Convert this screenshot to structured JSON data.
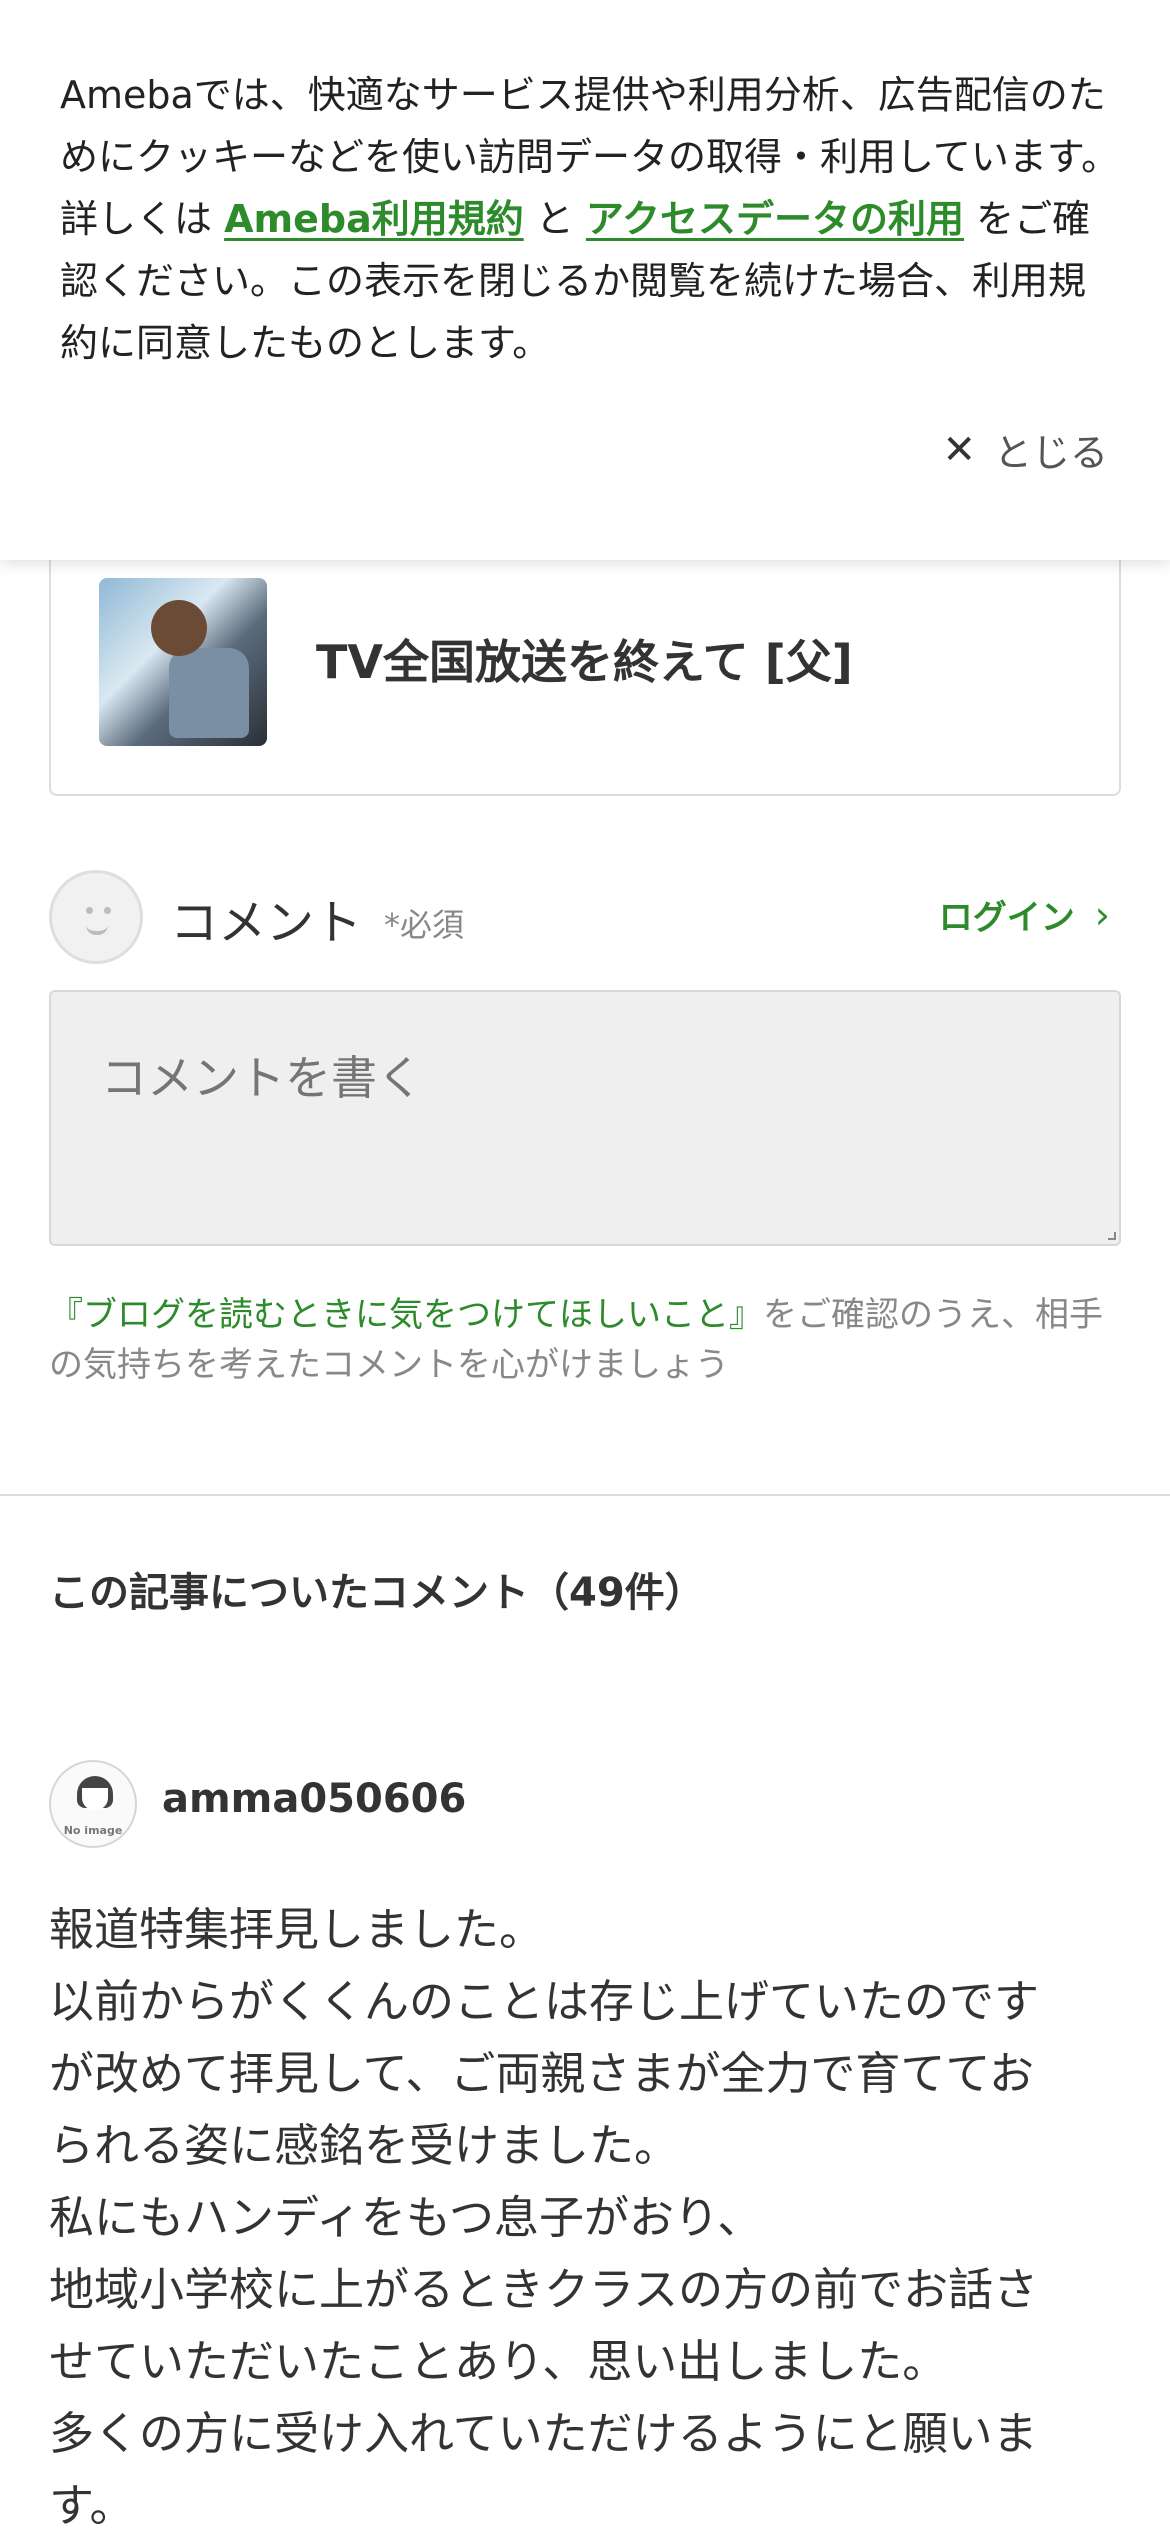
{
  "cookie_banner": {
    "text_1": "Amebaでは、快適なサービス提供や利用分析、広告配信のためにクッキーなどを使い訪問データの取得・利用しています。詳しくは ",
    "link_terms": "Ameba利用規約",
    "text_and": " と ",
    "link_access_data": "アクセスデータの利用",
    "text_2": " をご確認ください。この表示を閉じるか閲覧を続けた場合、利用規約に同意したものとします。",
    "close_label": "とじる",
    "close_icon": "close-icon"
  },
  "article_card": {
    "title": "TV全国放送を終えて [父]"
  },
  "comment_form": {
    "label": "コメント",
    "required": "*必須",
    "login_label": "ログイン",
    "placeholder": "コメントを書く",
    "guideline_link": "『ブログを読むときに気をつけてほしいこと』",
    "guideline_text": "をご確認のうえ、相手の気持ちを考えたコメントを心がけましょう"
  },
  "comments": {
    "heading": "この記事についたコメント（49件）",
    "items": [
      {
        "avatar_label": "No image",
        "author": "amma050606",
        "lines": [
          "報道特集拝見しました。",
          "以前からがくくんのことは存じ上げていたのです",
          "が改めて拝見して、ご両親さまが全力で育ててお",
          "られる姿に感銘を受けました。",
          "私にもハンディをもつ息子がおり、",
          "地域小学校に上がるときクラスの方の前でお話さ",
          "せていただいたことあり、思い出しました。",
          "多くの方に受け入れていただけるようにと願いま",
          "す。"
        ]
      }
    ]
  },
  "colors": {
    "accent_green": "#2d8b2b",
    "text_main": "#333333",
    "text_muted": "#888888"
  }
}
